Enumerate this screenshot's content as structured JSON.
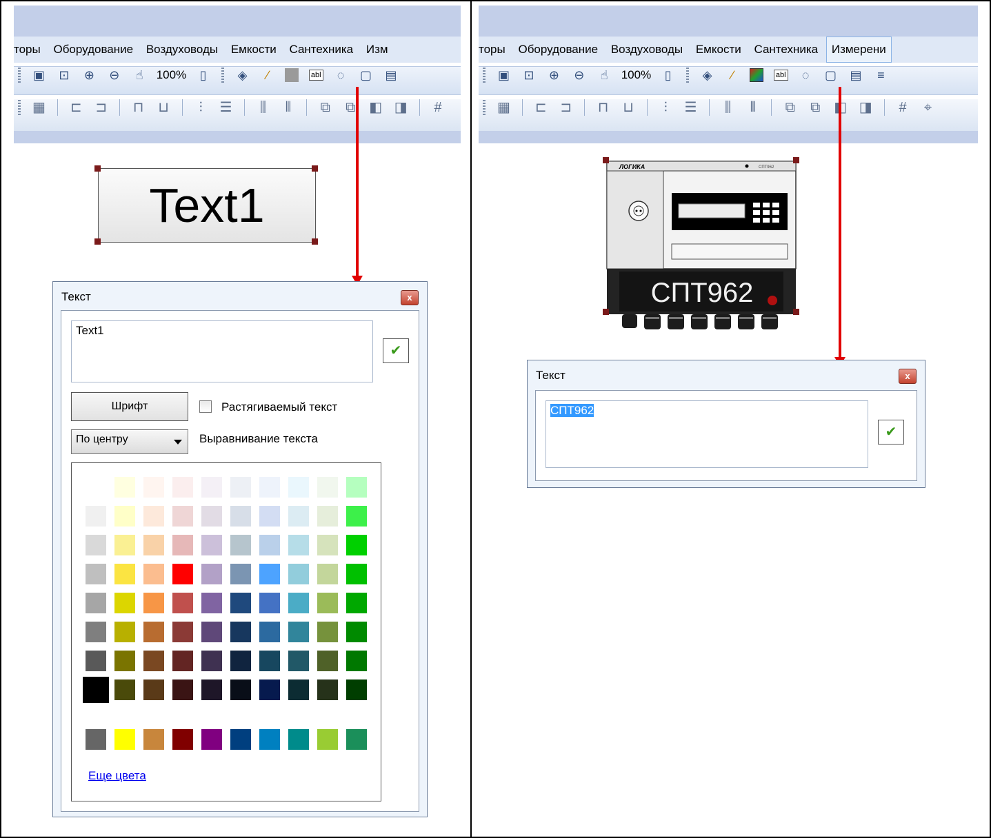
{
  "menu": {
    "left": [
      "торы",
      "Оборудование",
      "Воздуховоды",
      "Емкости",
      "Сантехника",
      "Изм"
    ],
    "right": [
      "торы",
      "Оборудование",
      "Воздуховоды",
      "Емкости",
      "Сантехника",
      "Измерени"
    ]
  },
  "toolbar": {
    "zoom": "100%",
    "text_tool": "abl"
  },
  "left_pane": {
    "object_text": "Text1",
    "dialog": {
      "title": "Текст",
      "close": "x",
      "text_value": "Text1",
      "font_button": "Шрифт",
      "stretch_label": "Растягиваемый текст",
      "align_value": "По центру",
      "align_label": "Выравнивание текста",
      "more_colors": "Еще цвета"
    }
  },
  "right_pane": {
    "device": {
      "brand": "ЛОГИКА",
      "model_small": "СПТ962",
      "label": "СПТ962"
    },
    "dialog": {
      "title": "Текст",
      "close": "x",
      "text_value": "СПТ962"
    }
  },
  "colors": {
    "arrow": "#e10000",
    "palette_rows": [
      [
        "#ffffff",
        "#ffffe0",
        "#fff5f0",
        "#fbeeee",
        "#f4f0f6",
        "#edf0f5",
        "#eef3fb",
        "#eaf7fd",
        "#f1f7ee",
        "#b5ffbf"
      ],
      [
        "#f0f0f0",
        "#ffffc8",
        "#fde9db",
        "#efd6d6",
        "#e2dce5",
        "#d7dee8",
        "#d3ddf3",
        "#dcecf3",
        "#e6eedb",
        "#3df04a"
      ],
      [
        "#d9d9d9",
        "#faf093",
        "#f9d2a8",
        "#e6b8b8",
        "#ccc0da",
        "#b6c5cd",
        "#bad0ea",
        "#b6dde8",
        "#d6e3bc",
        "#00d000"
      ],
      [
        "#bfbfbf",
        "#fbe442",
        "#fbbd8f",
        "#ff0000",
        "#b2a1c7",
        "#7b95b2",
        "#4da3ff",
        "#92cddc",
        "#c3d69b",
        "#00c000"
      ],
      [
        "#a6a6a6",
        "#dcd600",
        "#f79646",
        "#c0504d",
        "#8064a2",
        "#1f497d",
        "#4472c4",
        "#4bacc6",
        "#9bbb59",
        "#00a800"
      ],
      [
        "#7f7f7f",
        "#b8b000",
        "#b86c30",
        "#8b3a36",
        "#5f4879",
        "#17375e",
        "#2c6aa0",
        "#31859b",
        "#76923c",
        "#008a00"
      ],
      [
        "#595959",
        "#7a7400",
        "#7a4822",
        "#632523",
        "#3f3151",
        "#10243f",
        "#17475f",
        "#215867",
        "#4f6128",
        "#007800"
      ],
      [
        "#000000",
        "#4a4a0a",
        "#5a3a18",
        "#3a1414",
        "#1e1628",
        "#090e18",
        "#061a4e",
        "#0c2c33",
        "#26321a",
        "#003e00"
      ],
      [
        "#666666",
        "#ffff00",
        "#c8863c",
        "#800000",
        "#800080",
        "#003f7f",
        "#0080c0",
        "#008b8b",
        "#99cc33",
        "#1b8f5a"
      ]
    ]
  }
}
